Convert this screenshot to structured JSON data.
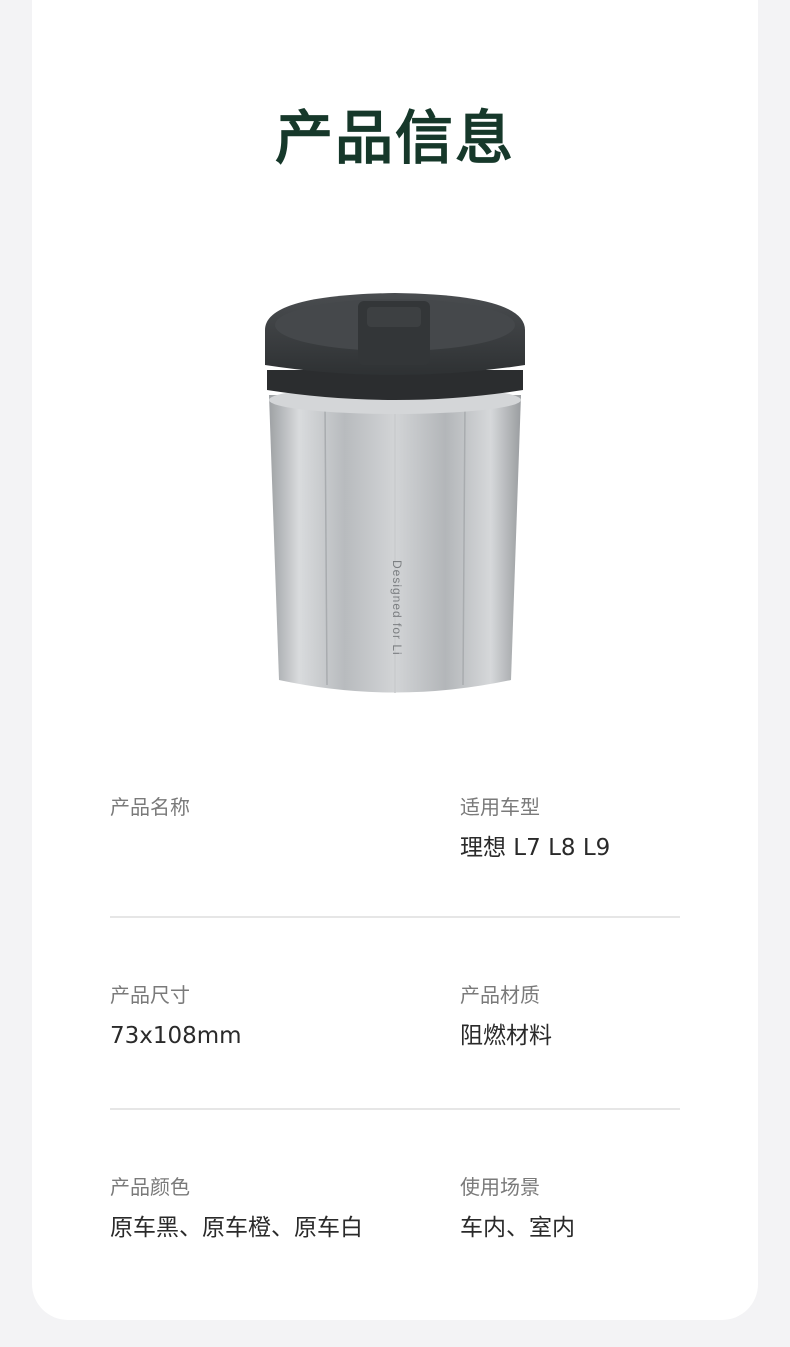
{
  "page": {
    "title": "产品信息"
  },
  "product_image": {
    "engraving": "Designed for Li"
  },
  "specs": [
    {
      "left": {
        "label": "产品名称",
        "value": ""
      },
      "right": {
        "label": "适用车型",
        "value": "理想 L7 L8 L9"
      }
    },
    {
      "left": {
        "label": "产品尺寸",
        "value": "73x108mm"
      },
      "right": {
        "label": "产品材质",
        "value": "阻燃材料"
      }
    },
    {
      "left": {
        "label": "产品颜色",
        "value": "原车黑、原车橙、原车白"
      },
      "right": {
        "label": "使用场景",
        "value": "车内、室内"
      }
    }
  ],
  "colors": {
    "title": "#16382a",
    "label": "#7a7a7a",
    "value": "#2a2a2a",
    "lid": "#3c3f42",
    "body": "#c4c6c8"
  }
}
